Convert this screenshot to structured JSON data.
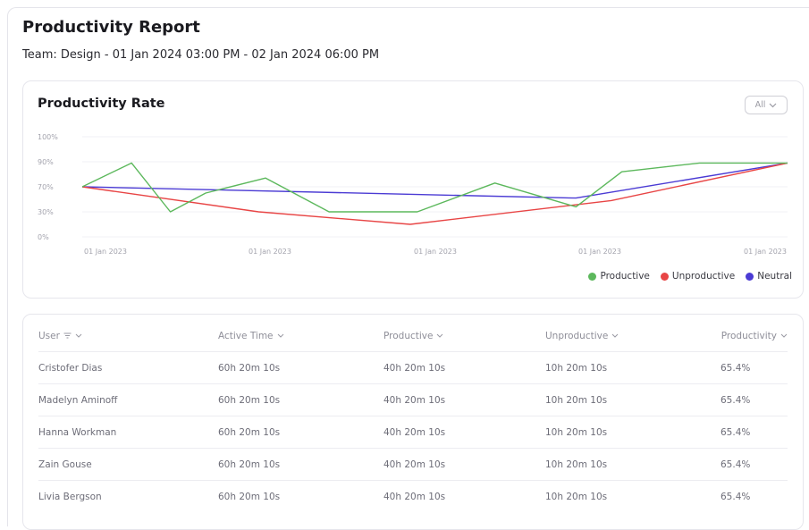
{
  "report": {
    "title": "Productivity Report",
    "subtitle": "Team: Design - 01 Jan 2024 03:00 PM - 02 Jan 2024 06:00 PM"
  },
  "chart_card": {
    "title": "Productivity Rate",
    "filter_value": "All"
  },
  "chart_data": {
    "type": "line",
    "y_tick_labels": [
      "100%",
      "90%",
      "70%",
      "30%",
      "0%"
    ],
    "x_tick_labels": [
      "01 Jan 2023",
      "01 Jan 2023",
      "01 Jan 2023",
      "01 Jan 2023",
      "01 Jan 2023"
    ],
    "grid": true,
    "legend_position": "bottom-right",
    "series": [
      {
        "name": "Productive",
        "color": "#5cb85c",
        "points": [
          [
            0,
            70
          ],
          [
            0.14,
            89
          ],
          [
            0.25,
            30
          ],
          [
            0.35,
            60
          ],
          [
            0.52,
            77
          ],
          [
            0.7,
            30
          ],
          [
            0.95,
            30
          ],
          [
            1.17,
            73
          ],
          [
            1.4,
            38
          ],
          [
            1.53,
            82
          ],
          [
            1.75,
            89
          ],
          [
            2.0,
            89
          ]
        ]
      },
      {
        "name": "Unproductive",
        "color": "#e84545",
        "points": [
          [
            0,
            70
          ],
          [
            0.5,
            30
          ],
          [
            0.93,
            15
          ],
          [
            1.5,
            48
          ],
          [
            2.0,
            89
          ]
        ]
      },
      {
        "name": "Neutral",
        "color": "#4b3bd4",
        "points": [
          [
            0,
            70
          ],
          [
            1.4,
            52
          ],
          [
            2.0,
            89
          ]
        ]
      }
    ]
  },
  "table": {
    "headers": {
      "user": "User",
      "active_time": "Active Time",
      "productive": "Productive",
      "unproductive": "Unproductive",
      "productivity": "Productivity"
    },
    "rows": [
      {
        "user": "Cristofer Dias",
        "active_time": "60h 20m 10s",
        "productive": "40h 20m 10s",
        "unproductive": "10h 20m 10s",
        "productivity": "65.4%"
      },
      {
        "user": "Madelyn Aminoff",
        "active_time": "60h 20m 10s",
        "productive": "40h 20m 10s",
        "unproductive": "10h 20m 10s",
        "productivity": "65.4%"
      },
      {
        "user": "Hanna Workman",
        "active_time": "60h 20m 10s",
        "productive": "40h 20m 10s",
        "unproductive": "10h 20m 10s",
        "productivity": "65.4%"
      },
      {
        "user": "Zain Gouse",
        "active_time": "60h 20m 10s",
        "productive": "40h 20m 10s",
        "unproductive": "10h 20m 10s",
        "productivity": "65.4%"
      },
      {
        "user": "Livia Bergson",
        "active_time": "60h 20m 10s",
        "productive": "40h 20m 10s",
        "unproductive": "10h 20m 10s",
        "productivity": "65.4%"
      }
    ]
  }
}
